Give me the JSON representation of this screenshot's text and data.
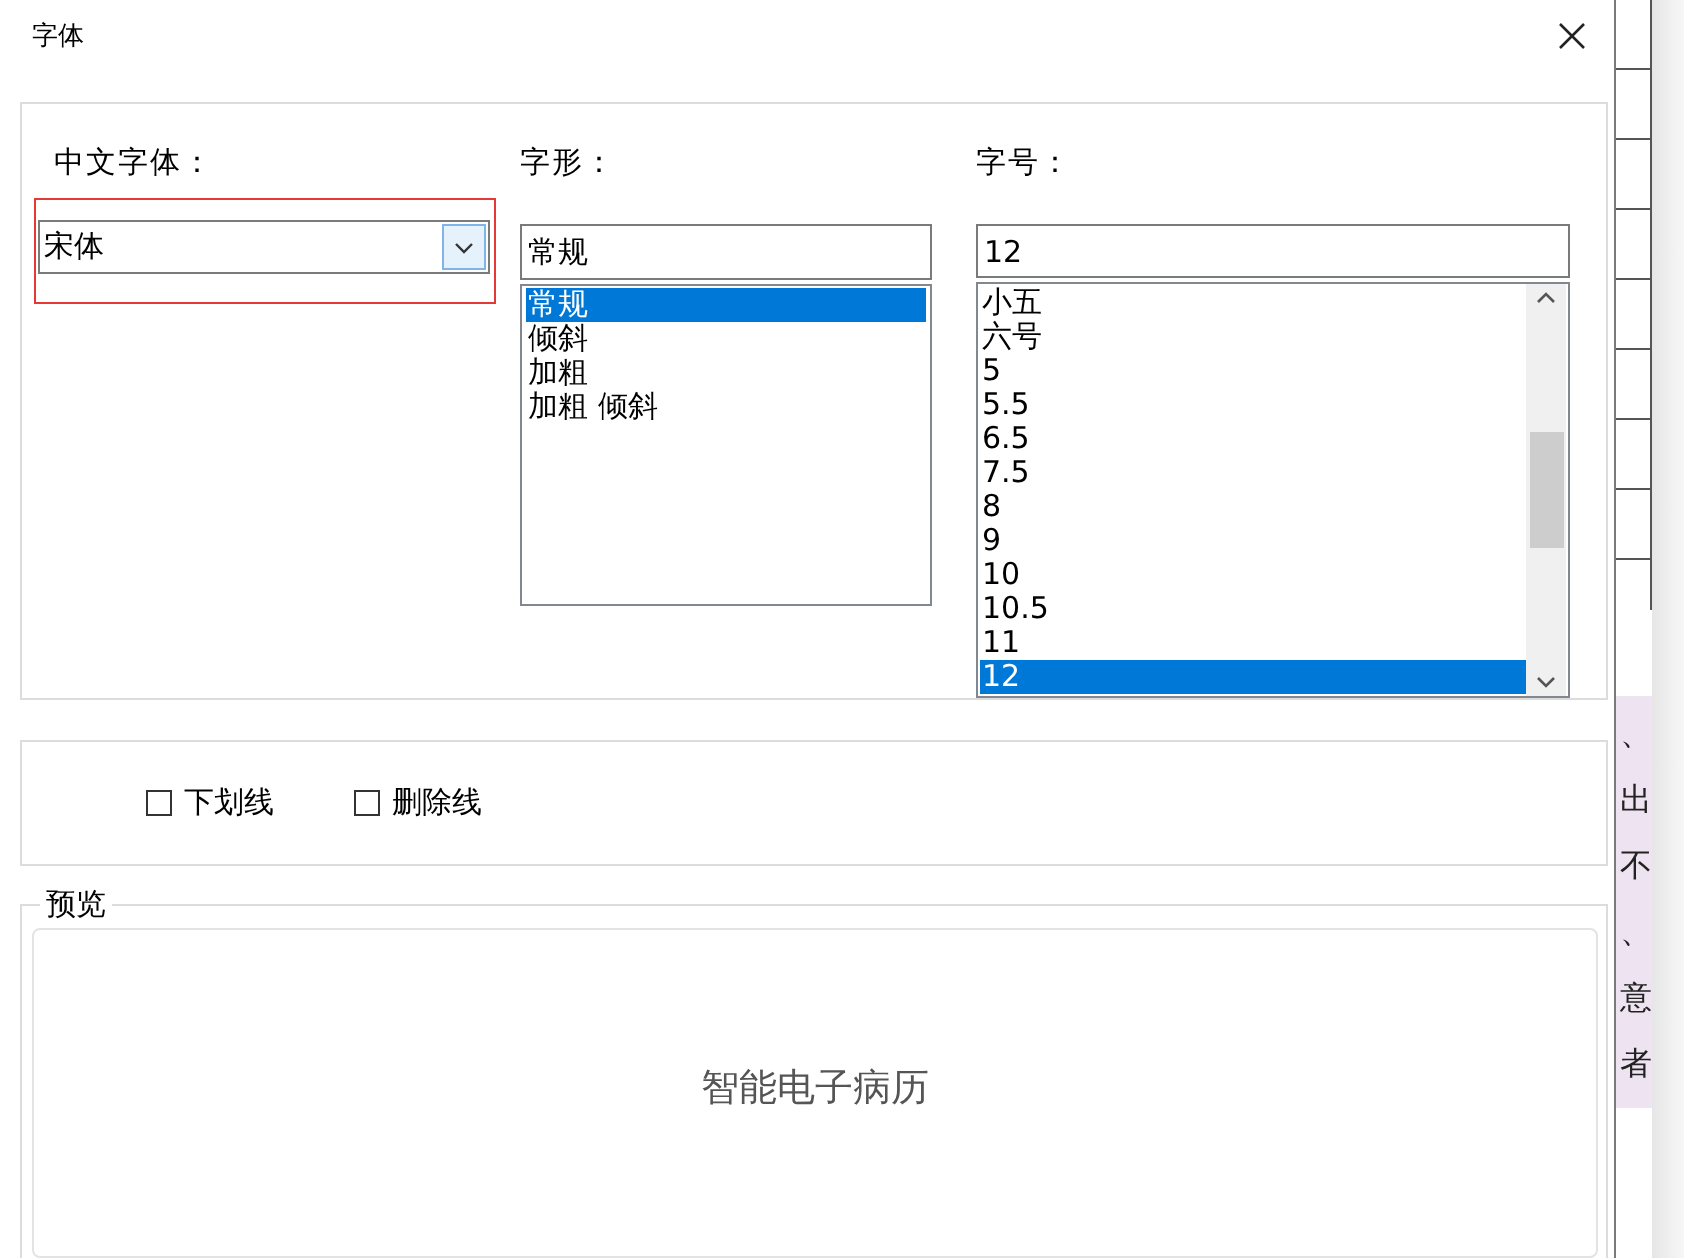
{
  "window": {
    "title": "字体"
  },
  "font_family": {
    "label": "中文字体：",
    "value": "宋体",
    "highlighted": true
  },
  "font_style": {
    "label": "字形：",
    "value": "常规",
    "options": [
      {
        "label": "常规",
        "selected": true
      },
      {
        "label": "倾斜",
        "selected": false
      },
      {
        "label": "加粗",
        "selected": false
      },
      {
        "label": "加粗 倾斜",
        "selected": false
      }
    ]
  },
  "font_size": {
    "label": "字号：",
    "value": "12",
    "options": [
      {
        "label": "小五",
        "selected": false
      },
      {
        "label": "六号",
        "selected": false
      },
      {
        "label": "5",
        "selected": false
      },
      {
        "label": "5.5",
        "selected": false
      },
      {
        "label": "6.5",
        "selected": false
      },
      {
        "label": "7.5",
        "selected": false
      },
      {
        "label": "8",
        "selected": false
      },
      {
        "label": "9",
        "selected": false
      },
      {
        "label": "10",
        "selected": false
      },
      {
        "label": "10.5",
        "selected": false
      },
      {
        "label": "11",
        "selected": false
      },
      {
        "label": "12",
        "selected": true
      }
    ]
  },
  "effects": [
    {
      "label": "下划线",
      "checked": false
    },
    {
      "label": "删除线",
      "checked": false
    }
  ],
  "preview": {
    "label": "预览",
    "sample": "智能电子病历"
  },
  "background_document": {
    "lines": [
      "、",
      "出",
      "不",
      "、",
      "意",
      "者"
    ]
  }
}
